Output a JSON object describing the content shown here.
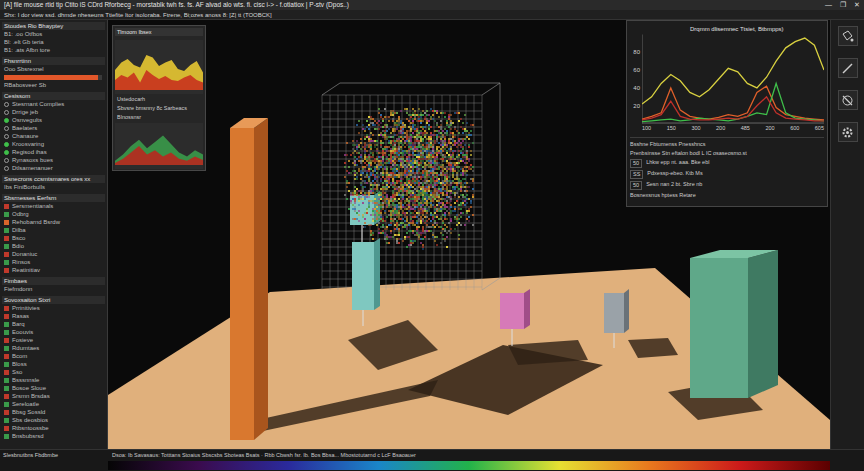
{
  "window": {
    "title": "[A] file mouse rtid tip Ctito iS CDrd Rforbecg - morstablk twh fs. fs. AF alvad alo wts. fi. cisc i-> - f.otiatiox | P-stv (Dpos..)",
    "controls": [
      "—",
      "❐",
      "✕"
    ]
  },
  "menu": {
    "text": "Shx: I dor view ssd. dhmde nheseuns Ttiefite Itor isoloraba. Ftrene, Bi;ozes anoss 8: [Z| tt (TOOBCK]"
  },
  "sidebar": {
    "sections": [
      {
        "header": "Stoudes Rio Bhayptey",
        "items": [
          {
            "kind": "text",
            "label": "B1: .oo Otfbos"
          },
          {
            "kind": "text",
            "label": "Bl: .elt Gb teria"
          },
          {
            "kind": "text",
            "label": "B1: .ats Afbn tore"
          }
        ]
      },
      {
        "header": "Fhsnrrtinn",
        "items": [
          {
            "kind": "text",
            "label": "Ooo Sbsrexnel"
          },
          {
            "kind": "bar",
            "level": 0.96
          },
          {
            "kind": "text",
            "label": "RBabosveer Sb"
          }
        ]
      },
      {
        "header": "Cesissom",
        "items": [
          {
            "kind": "circle",
            "label": "Stesrnant Complies",
            "checked": false
          },
          {
            "kind": "circle",
            "label": "Drrige jeb",
            "checked": false
          },
          {
            "kind": "circle",
            "label": "Osnvegults",
            "checked": true
          },
          {
            "kind": "circle",
            "label": "Baelaters",
            "checked": false
          },
          {
            "kind": "circle",
            "label": "Chanaure",
            "checked": false
          },
          {
            "kind": "circle",
            "label": "Kroosvaring",
            "checked": true
          },
          {
            "kind": "circle",
            "label": "Regisod ihas",
            "checked": true
          },
          {
            "kind": "circle",
            "label": "Rynasoxs bues",
            "checked": false
          },
          {
            "kind": "circle",
            "label": "Dtlsamenanuer",
            "checked": false
          }
        ]
      },
      {
        "header": "Ssnecrons ccsmtsmares ores xx",
        "items": [
          {
            "kind": "text",
            "label": "Ibs FiniBorbulls"
          }
        ]
      },
      {
        "header": "Sbsrnesses Eerfsrn",
        "items": [
          {
            "kind": "swatch",
            "label": "Sersmentianals",
            "color": "#c0392b"
          },
          {
            "kind": "swatch",
            "label": "Odbrg",
            "color": "#3a9a4a"
          },
          {
            "kind": "swatch",
            "label": "Rehobarnd Bsrdw",
            "color": "#d9662b"
          },
          {
            "kind": "swatch",
            "label": "Dilba",
            "color": "#3a9a4a"
          },
          {
            "kind": "swatch",
            "label": "Bsco",
            "color": "#c0392b"
          },
          {
            "kind": "swatch",
            "label": "Bdio",
            "color": "#3a9a4a"
          },
          {
            "kind": "swatch",
            "label": "Donaniuc",
            "color": "#c0392b"
          },
          {
            "kind": "swatch",
            "label": "Rinsos",
            "color": "#3a9a4a"
          },
          {
            "kind": "swatch",
            "label": "Reatinitiav",
            "color": "#c0392b"
          }
        ]
      },
      {
        "header": "Fimbaes",
        "items": [
          {
            "kind": "text",
            "label": "Fiefmdonn"
          }
        ]
      },
      {
        "header": "Sovoxsaiton Stxri",
        "items": [
          {
            "kind": "swatch",
            "label": "Prrinitivies",
            "color": "#c0392b"
          },
          {
            "kind": "swatch",
            "label": "Rasas",
            "color": "#c0392b"
          },
          {
            "kind": "swatch",
            "label": "Barq",
            "color": "#3a9a4a"
          },
          {
            "kind": "swatch",
            "label": "Eoouvis",
            "color": "#3a9a4a"
          },
          {
            "kind": "swatch",
            "label": "Fosieve",
            "color": "#c0392b"
          },
          {
            "kind": "swatch",
            "label": "Rdumtaes",
            "color": "#3a9a4a"
          },
          {
            "kind": "swatch",
            "label": "Bcom",
            "color": "#c0392b"
          },
          {
            "kind": "swatch",
            "label": "Bloss",
            "color": "#3a9a4a"
          },
          {
            "kind": "swatch",
            "label": "Sso",
            "color": "#c0392b"
          },
          {
            "kind": "swatch",
            "label": "Bsssnnsle",
            "color": "#3a9a4a"
          },
          {
            "kind": "swatch",
            "label": "Bosoe Sloue",
            "color": "#3a9a4a"
          },
          {
            "kind": "swatch",
            "label": "Srsmn Brsdas",
            "color": "#c0392b"
          },
          {
            "kind": "swatch",
            "label": "Sereloatle",
            "color": "#3a9a4a"
          },
          {
            "kind": "swatch",
            "label": "Bbsg Sossld",
            "color": "#c0392b"
          },
          {
            "kind": "swatch",
            "label": "Sbs deosbios",
            "color": "#3a9a4a"
          },
          {
            "kind": "swatch",
            "label": "Rtbsntoossbe",
            "color": "#c0392b"
          },
          {
            "kind": "swatch",
            "label": "Bnsbubsrsd",
            "color": "#3a9a4a"
          }
        ]
      }
    ]
  },
  "float_panel": {
    "title": "Tlmoom Ibsex",
    "chart_top": {
      "series": [
        {
          "color": "#e8c832",
          "values": [
            40,
            55,
            62,
            50,
            45,
            70,
            65,
            48,
            55,
            60,
            42,
            38,
            50,
            58,
            35
          ]
        },
        {
          "color": "#c8321e",
          "values": [
            20,
            30,
            25,
            35,
            15,
            40,
            30,
            22,
            28,
            20,
            18,
            25,
            30,
            20,
            15
          ]
        }
      ]
    },
    "labels": [
      "Ustedocarh",
      "Sbvsre bmsnny 8c Sarbeacs",
      "Blnossnsr"
    ],
    "chart_bottom": {
      "series": [
        {
          "color": "#3a9a4a",
          "values": [
            10,
            25,
            45,
            60,
            40,
            55,
            70,
            50,
            30,
            20,
            35,
            25
          ]
        },
        {
          "color": "#b8281e",
          "values": [
            5,
            15,
            30,
            45,
            25,
            35,
            20,
            30,
            15,
            10,
            20,
            12
          ]
        }
      ]
    }
  },
  "right_panel": {
    "title": "Drqmm dlisemnec Ttsiet, Btbmpps)",
    "y_ticks": [
      "80",
      "60",
      "40",
      "20"
    ],
    "x_ticks": [
      "100",
      "150",
      "300",
      "200",
      "485",
      "200",
      "600",
      "605"
    ],
    "series": [
      {
        "color": "#d8d040",
        "values": [
          22,
          30,
          45,
          55,
          48,
          35,
          30,
          38,
          50,
          62,
          58,
          45,
          40,
          52,
          70,
          85,
          92,
          96,
          88,
          60
        ]
      },
      {
        "color": "#e0602a",
        "values": [
          5,
          8,
          12,
          40,
          15,
          8,
          6,
          5,
          7,
          10,
          8,
          12,
          35,
          42,
          18,
          10,
          8,
          6,
          5,
          4
        ]
      },
      {
        "color": "#3fbf4a",
        "values": [
          2,
          3,
          4,
          5,
          3,
          4,
          6,
          5,
          4,
          3,
          5,
          8,
          12,
          10,
          45,
          12,
          6,
          5,
          4,
          3
        ]
      },
      {
        "color": "#c0302a",
        "values": [
          4,
          6,
          10,
          25,
          8,
          5,
          4,
          4,
          5,
          6,
          5,
          8,
          20,
          30,
          12,
          6,
          5,
          4,
          3,
          3
        ]
      }
    ],
    "info": {
      "header": "Bsshne Fbtumenss Pnesshncs",
      "note": "Prenbsinsse Stn eftalon bodl L IC osaseosmo.st",
      "rows": [
        {
          "id": "50",
          "text": "Lhkw epp nt. aaa. Bke ebl"
        },
        {
          "id": "SS",
          "text": "Pdxessp-ebeo. Ktb Ms"
        },
        {
          "id": "50",
          "text": "Sesn nan 2 bt. Sbre nb"
        }
      ],
      "footer": "Bosnexsnus hptess Retare"
    }
  },
  "bottom": {
    "label": "Slesbnutbns Fbdbmbe",
    "status": "Dsoa: Ib Savasaus: Totttans Stoaius Sbscsbs Sboteas Bsats · Rbb Cbwsh fsr. Ib. Bos Bbsa... Mbostotutarnd c LcF Bsaoauer"
  }
}
